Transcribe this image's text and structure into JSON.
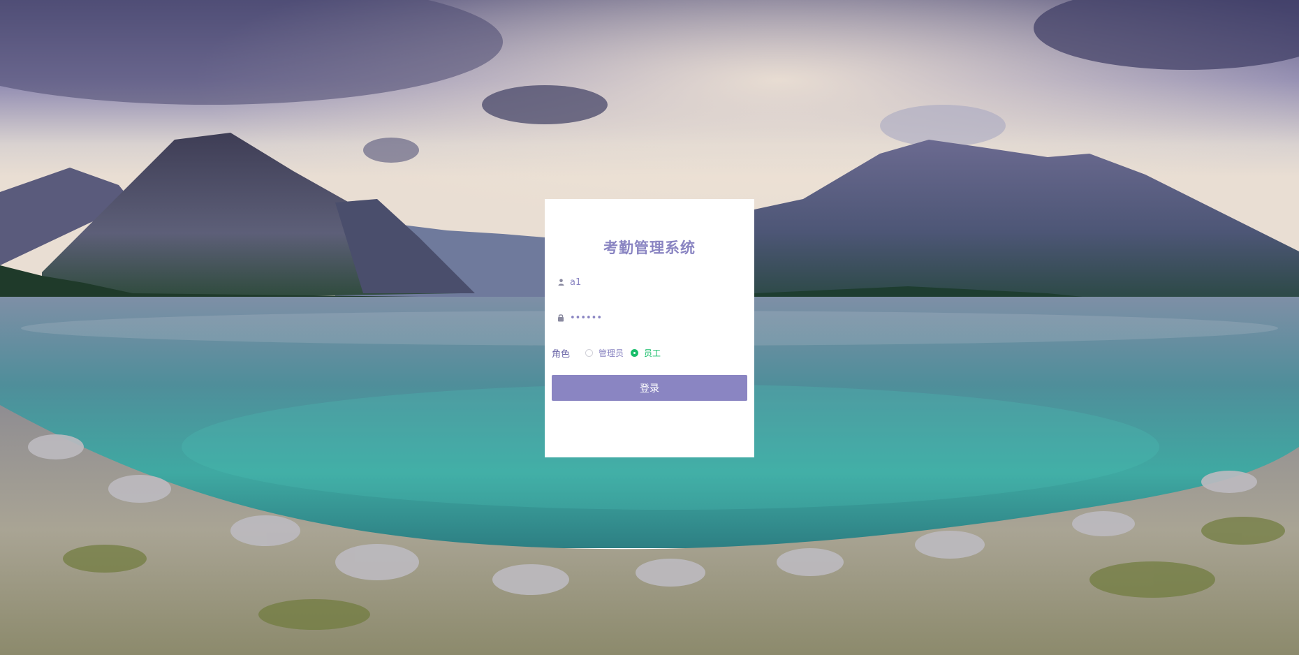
{
  "app": {
    "title": "考勤管理系统"
  },
  "login": {
    "username_value": "a1",
    "password_value": "••••••",
    "role_label": "角色",
    "roles": [
      {
        "label": "管理员",
        "checked": false
      },
      {
        "label": "员工",
        "checked": true
      }
    ],
    "submit_label": "登录"
  },
  "icons": {
    "user": "user-icon",
    "lock": "lock-icon"
  },
  "colors": {
    "accent": "#8a85c2",
    "selected": "#19be6b",
    "card": "#ffffff"
  }
}
